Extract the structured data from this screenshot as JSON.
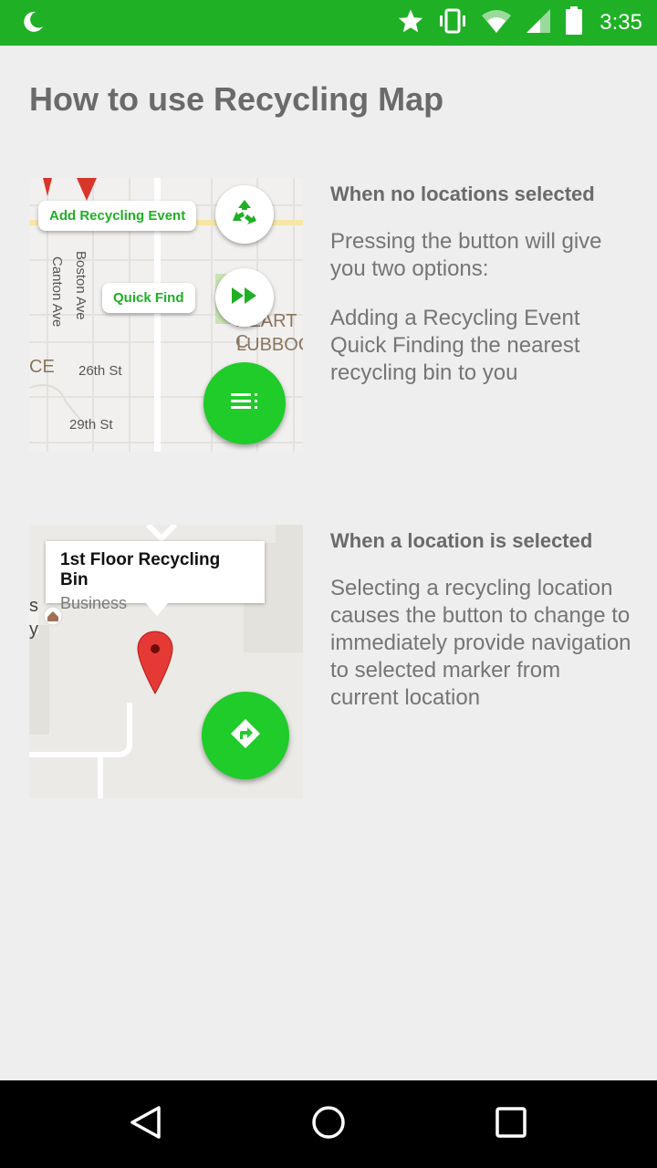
{
  "status_bar": {
    "time": "3:35",
    "icons": [
      "moon-icon",
      "star-icon",
      "vibrate-icon",
      "wifi-icon",
      "signal-icon",
      "battery-icon"
    ]
  },
  "page": {
    "title": "How to use Recycling Map"
  },
  "section1": {
    "heading": "When no locations selected",
    "body_line1": "Pressing the button will give you two options:",
    "body_line2": "Adding a Recycling Event Quick Finding the nearest recycling bin to you",
    "map": {
      "add_event_label": "Add Recycling Event",
      "quick_find_label": "Quick Find",
      "streets": [
        "Canton Ave",
        "Boston Ave",
        "26th St",
        "29th St"
      ],
      "poi_partial_1": "HEART C",
      "poi_partial_2": "LUBBOC",
      "edge_text": "CE"
    }
  },
  "section2": {
    "heading": "When a location is selected",
    "body": "Selecting a recycling location causes the button to change to immediately provide navigation to selected marker from current location",
    "map": {
      "info_title": "1st Floor Recycling Bin",
      "info_subtitle": "Business",
      "edge_text_1": "s",
      "edge_text_2": "y"
    }
  },
  "colors": {
    "accent": "#1fb025",
    "fab": "#1fcc2a",
    "marker": "#e53935"
  }
}
